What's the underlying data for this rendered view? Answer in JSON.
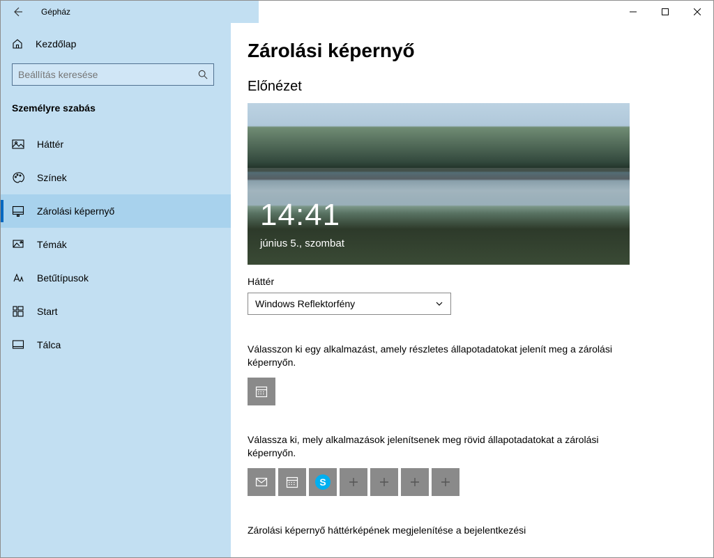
{
  "window": {
    "title": "Gépház"
  },
  "sidebar": {
    "home_label": "Kezdőlap",
    "search_placeholder": "Beállítás keresése",
    "section_title": "Személyre szabás",
    "items": [
      {
        "label": "Háttér"
      },
      {
        "label": "Színek"
      },
      {
        "label": "Zárolási képernyő"
      },
      {
        "label": "Témák"
      },
      {
        "label": "Betűtípusok"
      },
      {
        "label": "Start"
      },
      {
        "label": "Tálca"
      }
    ]
  },
  "main": {
    "heading": "Zárolási képernyő",
    "preview_label": "Előnézet",
    "preview": {
      "time": "14:41",
      "date": "június 5., szombat"
    },
    "background_label": "Háttér",
    "background_value": "Windows Reflektorfény",
    "detailed_desc": "Válasszon ki egy alkalmazást, amely részletes állapotadatokat jelenít meg a zárolási képernyőn.",
    "quick_desc": "Válassza ki, mely alkalmazások jelenítsenek meg rövid állapotadatokat a zárolási képernyőn.",
    "signin_bg_label": "Zárolási képernyő háttérképének megjelenítése a bejelentkezési"
  }
}
